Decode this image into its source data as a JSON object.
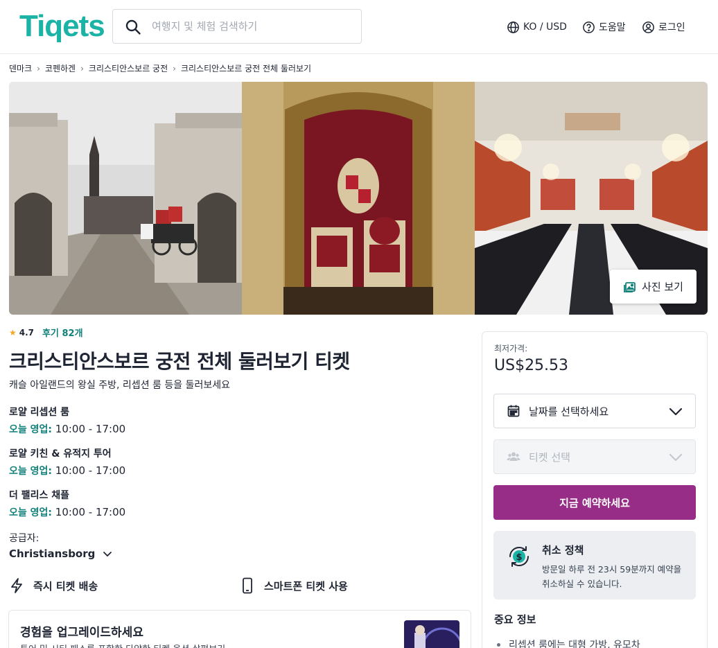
{
  "brand": {
    "logo_text": "Tiqets",
    "accent": "#1ab3a6",
    "cta_color": "#972d87",
    "link_color": "#11807a"
  },
  "header": {
    "search_placeholder": "여행지 및 체험 검색하기",
    "locale_label": "KO / USD",
    "help_label": "도움말",
    "login_label": "로그인"
  },
  "breadcrumb": [
    "덴마크",
    "코펜하겐",
    "크리스티안스보르 궁전",
    "크리스티안스보르 궁전 전체 둘러보기"
  ],
  "gallery": {
    "photos_button": "사진 보기"
  },
  "product": {
    "rating": "4.7",
    "reviews": "후기 82개",
    "title": "크리스티안스보르 궁전 전체 둘러보기 티켓",
    "subtitle": "캐슬 아일랜드의 왕실 주방, 리셉션 룸 등을 둘러보세요",
    "venues": [
      {
        "name": "로얄 리셉션 룸",
        "hours_label": "오늘 영업:",
        "hours": "10:00 - 17:00"
      },
      {
        "name": "로얄 키친 & 유적지 투어",
        "hours_label": "오늘 영업:",
        "hours": "10:00 - 17:00"
      },
      {
        "name": "더 팰리스 채플",
        "hours_label": "오늘 영업:",
        "hours": "10:00 - 17:00"
      }
    ],
    "supplier_label": "공급자:",
    "supplier_name": "Christiansborg",
    "features": [
      "즉시 티켓 배송",
      "스마트폰 티켓 사용"
    ],
    "upgrade": {
      "title": "경험을 업그레이드하세요",
      "text": "투어 및 시티 패스를 포함한 다양한 티켓 옵션 살펴보기"
    }
  },
  "booking": {
    "price_label": "최저가격:",
    "price": "US$25.53",
    "date_select": "날짜를 선택하세요",
    "ticket_select": "티켓 선택",
    "book_button": "지금 예약하세요",
    "policy_title": "취소 정책",
    "policy_text": "방문일 하루 전 23시 59분까지 예약을 취소하실 수 있습니다.",
    "info_title": "중요 정보",
    "info_items": [
      "리셉션 룸에는 대형 가방, 유모차"
    ]
  }
}
